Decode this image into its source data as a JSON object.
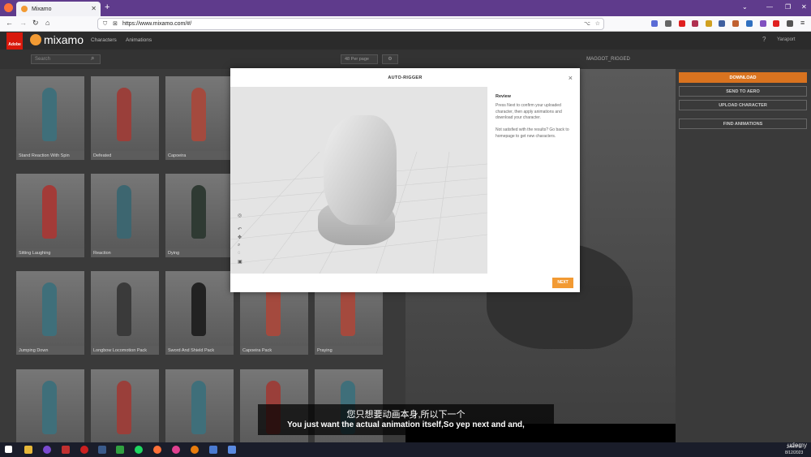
{
  "browser": {
    "tab_title": "Mixamo",
    "url": "https://www.mixamo.com/#/"
  },
  "header": {
    "logo_text": "mixamo",
    "adobe_label": "Adobe",
    "nav": [
      "Characters",
      "Animations"
    ],
    "user": "Yaraport"
  },
  "toolbar": {
    "search_placeholder": "Search",
    "per_page": "48 Per page",
    "character_name": "MAGGOT_RIGGED"
  },
  "animations": [
    {
      "label": "Stand Reaction With Spin",
      "color": "#3f6f7a"
    },
    {
      "label": "Defeated",
      "color": "#9a3f3a"
    },
    {
      "label": "Capoeira",
      "color": "#a44a3e"
    },
    {
      "label": "Sitting Laughing",
      "color": "#a33b38"
    },
    {
      "label": "Reaction",
      "color": "#3d6670"
    },
    {
      "label": "Dying",
      "color": "#2f3a33"
    },
    {
      "label": "Jumping Down",
      "color": "#3f6f7a"
    },
    {
      "label": "Longbow Locomotion Pack",
      "color": "#3a3a3a"
    },
    {
      "label": "Sword And Shield Pack",
      "color": "#222222"
    },
    {
      "label": "Capoeira Pack",
      "color": "#a44a3e"
    },
    {
      "label": "Praying",
      "color": "#a44a3e"
    },
    {
      "label": "",
      "color": "#3f6f7a"
    },
    {
      "label": "",
      "color": "#9a3f3a"
    },
    {
      "label": "",
      "color": "#3f6f7a"
    },
    {
      "label": "",
      "color": "#9a3f3a"
    },
    {
      "label": "",
      "color": "#3f6f7a"
    }
  ],
  "right_panel": {
    "download": "DOWNLOAD",
    "send_to_aero": "SEND TO AERO",
    "upload_character": "UPLOAD CHARACTER",
    "find_animations": "FIND ANIMATIONS"
  },
  "modal": {
    "title": "AUTO-RIGGER",
    "review_title": "Review",
    "review_text_1": "Press Next to confirm your uploaded character, then apply animations and download your character.",
    "review_text_2": "Not satisfied with the results? Go back to homepage to get new characters.",
    "next_label": "NEXT"
  },
  "subtitles": {
    "chinese": "您只想要动画本身,所以下一个",
    "english": "You just want the actual animation itself,So yep next and and,"
  },
  "taskbar": {
    "watermark": "udemy",
    "time": "2:44 PM",
    "date": "8/12/2023"
  }
}
